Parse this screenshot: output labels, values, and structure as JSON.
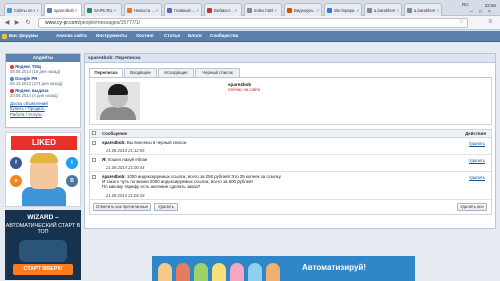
{
  "browser": {
    "tabs": [
      {
        "label": "Сайты по т...",
        "color": "#4a9ad8"
      },
      {
        "label": "spare4bob",
        "color": "#5b7fab",
        "active": true
      },
      {
        "label": "SAPE.RU",
        "color": "#2e8b57"
      },
      {
        "label": "Новости ...",
        "color": "#e07b2a"
      },
      {
        "label": "Главный ...",
        "color": "#4a6fb8"
      },
      {
        "label": "Вебмаст...",
        "color": "#c0392b"
      },
      {
        "label": "Index.html",
        "color": "#888888"
      },
      {
        "label": "Видеоуро...",
        "color": "#d35400"
      },
      {
        "label": "site:lopapa...",
        "color": "#3a7bd5"
      },
      {
        "label": "a.barakhom...",
        "color": "#7f8c8d"
      },
      {
        "label": "a.barakhom...",
        "color": "#7f8c8d"
      }
    ],
    "tab_close": "×",
    "lang": "RU",
    "clock": "22:56",
    "window_controls": [
      "–",
      "□",
      "×"
    ],
    "url_domain": "www.cy-pr.com",
    "url_path": "/people/messages/15777/1/",
    "back": "◀",
    "forward": "▶",
    "reload": "↻",
    "star": "☆",
    "menu": "≡"
  },
  "site_nav": {
    "items": [
      "Бис форумы",
      "Анализ сайта",
      "Инструменты",
      "Хостинг",
      "Статьи",
      "Блоги",
      "Сообщества"
    ]
  },
  "sidebar": {
    "header": "Апдейты",
    "entries": [
      {
        "name": "Яндекс ТИЦ",
        "date": "08.08.2014 (16 дня назад)",
        "color": "#e8302a"
      },
      {
        "name": "Google PR",
        "date": "06.12.2013 (274 дня назад)",
        "color": "#4285f4"
      },
      {
        "name": "Яндекс выдача",
        "date": "20.08.2014 (4 дня назад)",
        "color": "#e8302a"
      }
    ],
    "links": [
      "Доска объявлений",
      "Купить / Продать",
      "Работа / Услуги"
    ]
  },
  "ads": {
    "liked": "LIKED",
    "wizard_title": "WIZARD –",
    "wizard_sub": "АВТОМАТИЧЕСКИЙ СТАРТ В ТОП",
    "wizard_cta": "СТАРТ ВВЕРХ!",
    "bottom_text": "Автоматизируй!"
  },
  "main": {
    "title": "spare4bob: Переписка",
    "tabs": [
      "Переписка",
      "Входящие",
      "Исходящие",
      "Черный список"
    ],
    "username": "spare4bob",
    "user_status": "Сейчас на сайте",
    "table_header": {
      "message": "Сообщение",
      "actions": "Действия"
    },
    "messages": [
      {
        "author": "spare4bob:",
        "text": "Вы внесены в черный список",
        "date": "21.08.2014 21:12:55",
        "action": "Удалить"
      },
      {
        "author": "Я:",
        "text": "пошел нахуй еблан",
        "date": "21.08.2014 21:00:44",
        "action": "Удалить"
      },
      {
        "author": "spare4bob:",
        "text": "1000 индексируемых ссылок, всего за 250 рублей! Это 25 копеек за ссылку.",
        "text2": "И такого чуть по жизни 2000 индексируемых ссылок, всего за 500 рублей!",
        "text3": "По какому тарифу есть желание сделать заказ?",
        "date": "21.08.2014 21:04:18",
        "action": "Удалить"
      }
    ],
    "btn_mark_read": "Отметить как прочитанные",
    "btn_delete": "Удалить",
    "btn_delete_all": "Удалить все"
  }
}
